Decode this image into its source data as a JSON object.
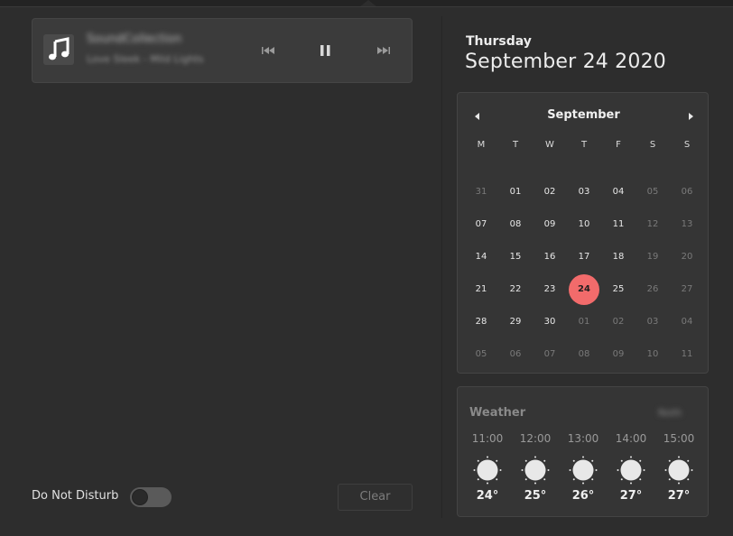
{
  "media": {
    "track_title": "SoundCollection",
    "track_artist": "Love Sleek - Mild Lights",
    "prev_label": "previous",
    "play_pause_state": "playing",
    "next_label": "next"
  },
  "dnd": {
    "label": "Do Not Disturb",
    "enabled": false
  },
  "clear_label": "Clear",
  "date": {
    "weekday": "Thursday",
    "full": "September 24 2020"
  },
  "calendar": {
    "month": "September",
    "weekdays": [
      "M",
      "T",
      "W",
      "T",
      "F",
      "S",
      "S"
    ],
    "weeks": [
      [
        {
          "d": "31",
          "dim": true
        },
        {
          "d": "01"
        },
        {
          "d": "02"
        },
        {
          "d": "03"
        },
        {
          "d": "04"
        },
        {
          "d": "05",
          "dim": true
        },
        {
          "d": "06",
          "dim": true
        }
      ],
      [
        {
          "d": "07"
        },
        {
          "d": "08"
        },
        {
          "d": "09"
        },
        {
          "d": "10"
        },
        {
          "d": "11"
        },
        {
          "d": "12",
          "dim": true
        },
        {
          "d": "13",
          "dim": true
        }
      ],
      [
        {
          "d": "14"
        },
        {
          "d": "15"
        },
        {
          "d": "16"
        },
        {
          "d": "17"
        },
        {
          "d": "18"
        },
        {
          "d": "19",
          "dim": true
        },
        {
          "d": "20",
          "dim": true
        }
      ],
      [
        {
          "d": "21"
        },
        {
          "d": "22"
        },
        {
          "d": "23"
        },
        {
          "d": "24",
          "today": true
        },
        {
          "d": "25"
        },
        {
          "d": "26",
          "dim": true
        },
        {
          "d": "27",
          "dim": true
        }
      ],
      [
        {
          "d": "28"
        },
        {
          "d": "29"
        },
        {
          "d": "30"
        },
        {
          "d": "01",
          "dim": true
        },
        {
          "d": "02",
          "dim": true
        },
        {
          "d": "03",
          "dim": true
        },
        {
          "d": "04",
          "dim": true
        }
      ],
      [
        {
          "d": "05",
          "dim": true
        },
        {
          "d": "06",
          "dim": true
        },
        {
          "d": "07",
          "dim": true
        },
        {
          "d": "08",
          "dim": true
        },
        {
          "d": "09",
          "dim": true
        },
        {
          "d": "10",
          "dim": true
        },
        {
          "d": "11",
          "dim": true
        }
      ]
    ],
    "today_color": "#f26b6b"
  },
  "weather": {
    "title": "Weather",
    "location": "Noth",
    "icon": "sun-icon",
    "forecast": [
      {
        "time": "11:00",
        "temp": "24°"
      },
      {
        "time": "12:00",
        "temp": "25°"
      },
      {
        "time": "13:00",
        "temp": "26°"
      },
      {
        "time": "14:00",
        "temp": "27°"
      },
      {
        "time": "15:00",
        "temp": "27°"
      }
    ]
  }
}
